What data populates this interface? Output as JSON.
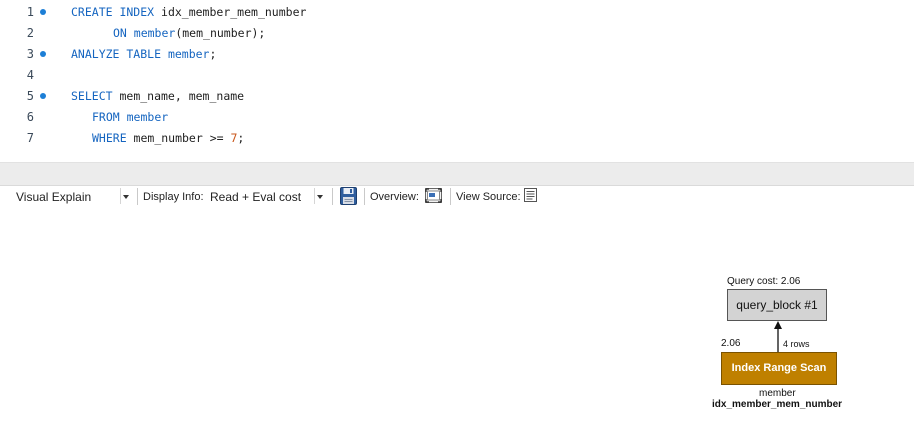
{
  "editor": {
    "lines": [
      {
        "num": "1",
        "marker": true,
        "tokens": [
          {
            "t": "CREATE INDEX ",
            "c": "kw"
          },
          {
            "t": "idx_member_mem_number",
            "c": "plain"
          }
        ]
      },
      {
        "num": "2",
        "marker": false,
        "tokens": [
          {
            "t": "ON ",
            "c": "kw"
          },
          {
            "t": "member",
            "c": "kw"
          },
          {
            "t": "(mem_number);",
            "c": "plain"
          }
        ]
      },
      {
        "num": "3",
        "marker": true,
        "tokens": [
          {
            "t": "ANALYZE TABLE ",
            "c": "kw"
          },
          {
            "t": "member",
            "c": "kw"
          },
          {
            "t": ";",
            "c": "plain"
          }
        ]
      },
      {
        "num": "4",
        "marker": false,
        "tokens": []
      },
      {
        "num": "5",
        "marker": true,
        "tokens": [
          {
            "t": "SELECT ",
            "c": "kw"
          },
          {
            "t": "mem_name, mem_name",
            "c": "plain"
          }
        ]
      },
      {
        "num": "6",
        "marker": false,
        "tokens": [
          {
            "t": "FROM ",
            "c": "kw"
          },
          {
            "t": "member",
            "c": "kw"
          }
        ]
      },
      {
        "num": "7",
        "marker": false,
        "tokens": [
          {
            "t": "WHERE ",
            "c": "kw"
          },
          {
            "t": "mem_number >= ",
            "c": "plain"
          },
          {
            "t": "7",
            "c": "num"
          },
          {
            "t": ";",
            "c": "plain"
          }
        ]
      }
    ]
  },
  "toolbar": {
    "view_mode": "Visual Explain",
    "display_info_label": "Display Info:",
    "display_info_value": "Read + Eval cost",
    "overview_label": "Overview:",
    "view_source_label": "View Source:",
    "icons": [
      "save-icon",
      "overview-icon",
      "view-source-icon"
    ]
  },
  "explain": {
    "query_cost_label": "Query cost: 2.06",
    "query_block_label": "query_block #1",
    "edge_cost": "2.06",
    "edge_rows": "4 rows",
    "scan_label": "Index Range Scan",
    "table_name": "member",
    "index_name": "idx_member_mem_number"
  },
  "colors": {
    "keyword": "#1565c0",
    "number": "#c9571b",
    "marker": "#1d7fd6",
    "query_block_fill": "#d3d3d3",
    "range_scan_fill": "#bf8000"
  }
}
